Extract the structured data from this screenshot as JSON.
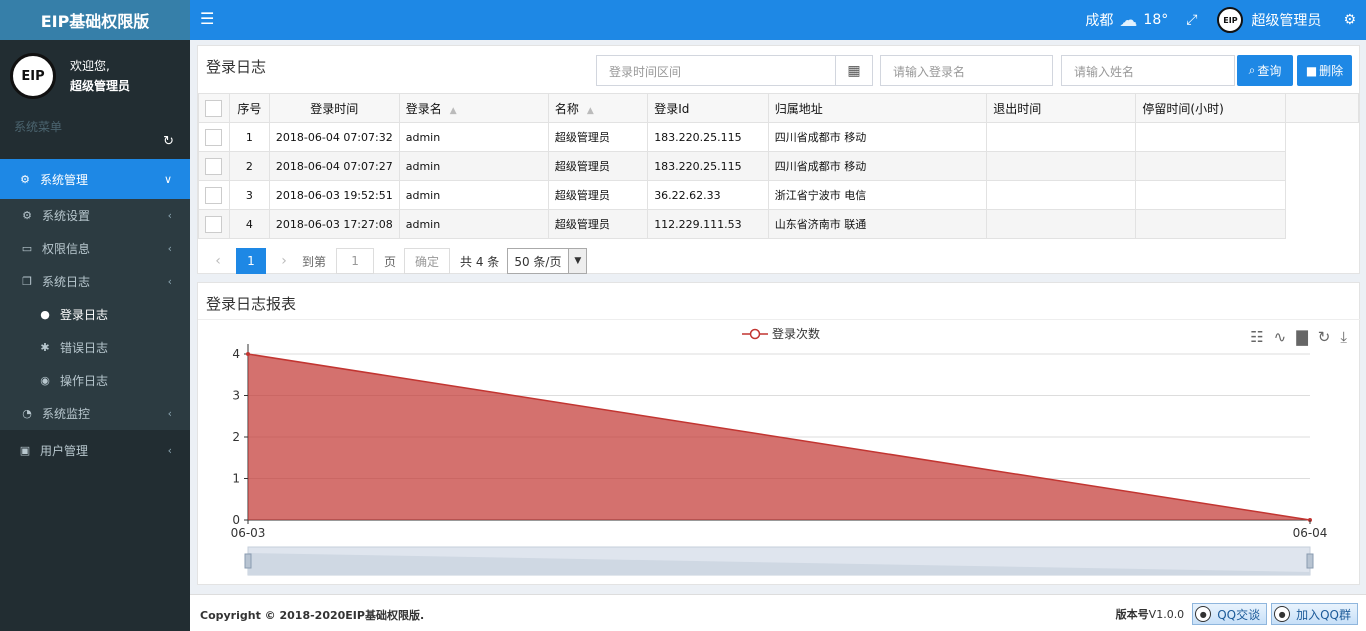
{
  "app": {
    "title": "EIP基础权限版",
    "logo_text": "EIP"
  },
  "user_panel": {
    "greeting": "欢迎您,",
    "name": "超级管理员"
  },
  "sidebar": {
    "header": "系统菜单",
    "refresh_icon": "refresh-icon",
    "items": [
      {
        "label": "系统管理",
        "icon": "gear-icon",
        "active": true
      },
      {
        "label": "系统设置",
        "icon": "gear-outline-icon"
      },
      {
        "label": "权限信息",
        "icon": "desktop-icon"
      },
      {
        "label": "系统日志",
        "icon": "copy-icon"
      },
      {
        "label": "登录日志",
        "icon": "user-icon",
        "current": true
      },
      {
        "label": "错误日志",
        "icon": "bug-icon"
      },
      {
        "label": "操作日志",
        "icon": "eye-icon"
      },
      {
        "label": "系统监控",
        "icon": "dashboard-icon"
      },
      {
        "label": "用户管理",
        "icon": "id-card-icon"
      }
    ]
  },
  "topbar": {
    "city": "成都",
    "temperature": "18°",
    "user_name": "超级管理员"
  },
  "log_panel": {
    "title": "登录日志",
    "date_range_placeholder": "登录时间区间",
    "login_name_placeholder": "请输入登录名",
    "name_placeholder": "请输入姓名",
    "query_label": "查询",
    "delete_label": "删除",
    "columns": [
      "序号",
      "登录时间",
      "登录名",
      "名称",
      "登录Id",
      "归属地址",
      "退出时间",
      "停留时间(小时)"
    ],
    "rows": [
      {
        "no": "1",
        "time": "2018-06-04 07:07:32",
        "login": "admin",
        "name": "超级管理员",
        "ip": "183.220.25.115",
        "location": "四川省成都市 移动",
        "logout": "",
        "stay": ""
      },
      {
        "no": "2",
        "time": "2018-06-04 07:07:27",
        "login": "admin",
        "name": "超级管理员",
        "ip": "183.220.25.115",
        "location": "四川省成都市 移动",
        "logout": "",
        "stay": ""
      },
      {
        "no": "3",
        "time": "2018-06-03 19:52:51",
        "login": "admin",
        "name": "超级管理员",
        "ip": "36.22.62.33",
        "location": "浙江省宁波市 电信",
        "logout": "",
        "stay": ""
      },
      {
        "no": "4",
        "time": "2018-06-03 17:27:08",
        "login": "admin",
        "name": "超级管理员",
        "ip": "112.229.111.53",
        "location": "山东省济南市 联通",
        "logout": "",
        "stay": ""
      }
    ]
  },
  "pager": {
    "current_page": "1",
    "goto_label": "到第",
    "goto_value": "1",
    "page_unit": "页",
    "confirm_label": "确定",
    "total_label": "共 4 条",
    "page_size": "50 条/页"
  },
  "report_panel": {
    "title": "登录日志报表"
  },
  "chart_data": {
    "type": "area",
    "categories": [
      "06-03",
      "06-04"
    ],
    "series": [
      {
        "name": "登录次数",
        "values": [
          4,
          0
        ],
        "color": "#c23531"
      }
    ],
    "y_ticks": [
      "0",
      "1",
      "2",
      "3",
      "4"
    ],
    "ylim": [
      0,
      4
    ],
    "legend": "top-center",
    "grid": true,
    "tools": [
      "data-view-icon",
      "line-chart-icon",
      "bar-chart-icon",
      "restore-icon",
      "download-icon"
    ]
  },
  "footer": {
    "copyright": "Copyright © 2018-2020EIP基础权限版.",
    "version_label": "版本号",
    "version": "V1.0.0",
    "qq_chat": "QQ交谈",
    "qq_group": "加入QQ群"
  }
}
